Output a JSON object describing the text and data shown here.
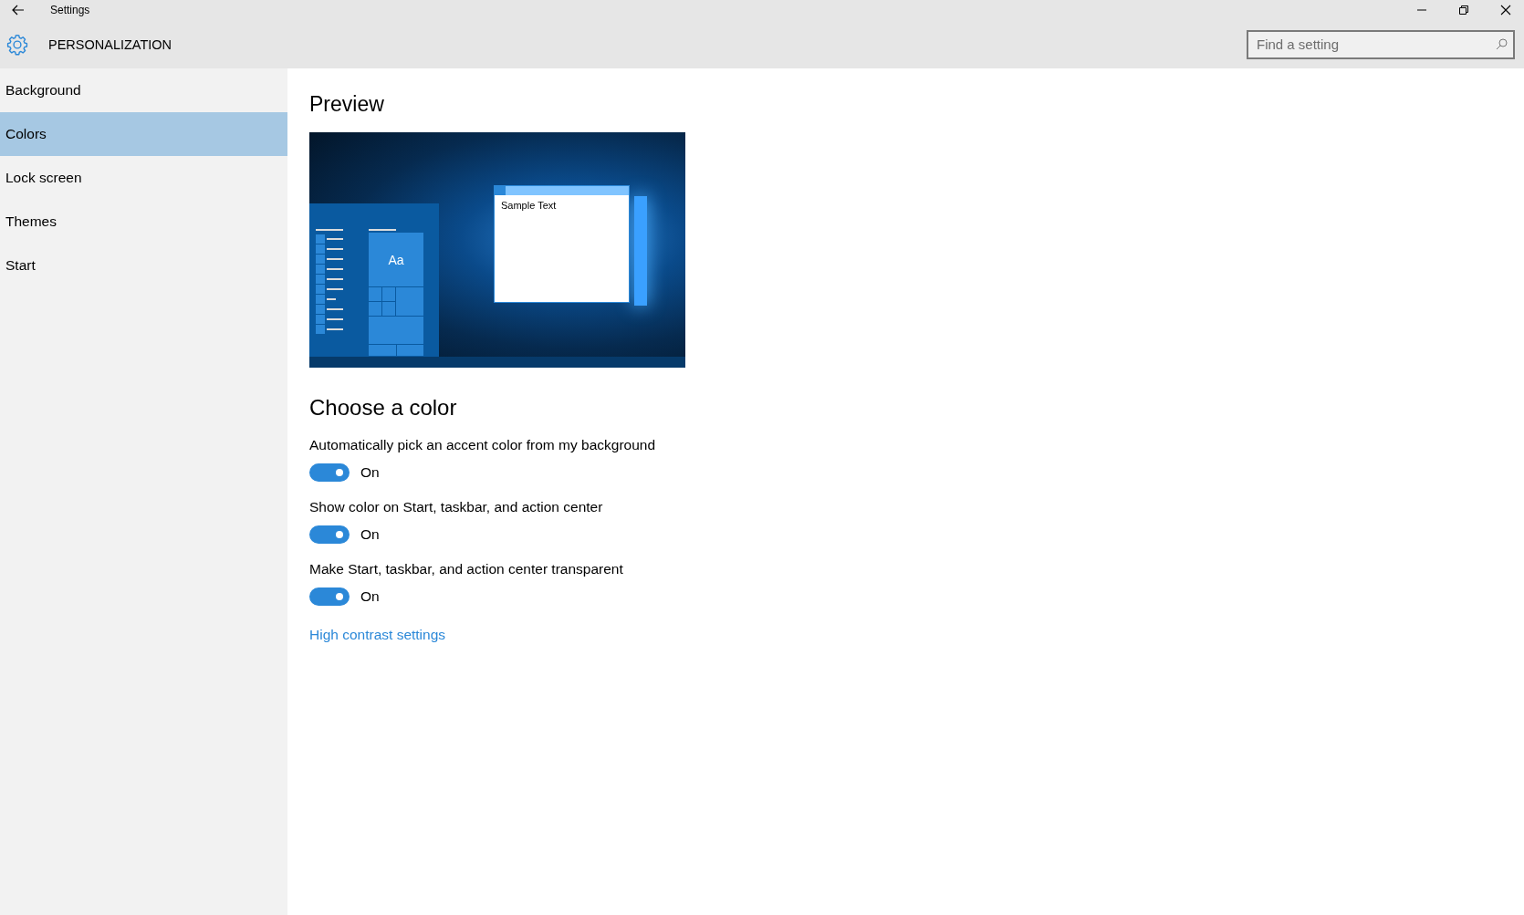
{
  "window": {
    "title": "Settings"
  },
  "header": {
    "title": "PERSONALIZATION",
    "search": {
      "placeholder": "Find a setting"
    }
  },
  "sidebar": {
    "items": [
      {
        "label": "Background",
        "selected": false
      },
      {
        "label": "Colors",
        "selected": true
      },
      {
        "label": "Lock screen",
        "selected": false
      },
      {
        "label": "Themes",
        "selected": false
      },
      {
        "label": "Start",
        "selected": false
      }
    ]
  },
  "preview": {
    "heading": "Preview",
    "tile_text": "Aa",
    "window_text": "Sample Text"
  },
  "colors": {
    "heading": "Choose a color",
    "settings": [
      {
        "label": "Automatically pick an accent color from my background",
        "on": true,
        "state_text": "On"
      },
      {
        "label": "Show color on Start, taskbar, and action center",
        "on": true,
        "state_text": "On"
      },
      {
        "label": "Make Start, taskbar, and action center transparent",
        "on": true,
        "state_text": "On"
      }
    ],
    "link": "High contrast settings"
  }
}
